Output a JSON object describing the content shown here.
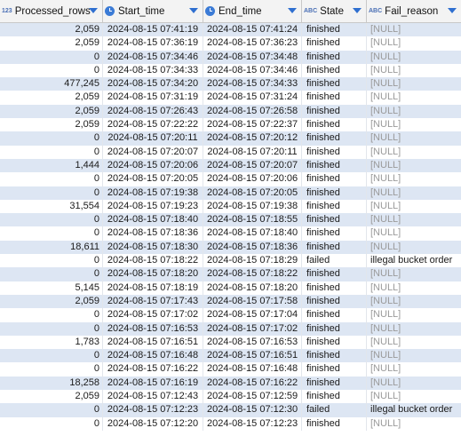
{
  "columns": {
    "processed_rows": {
      "type_icon": "123",
      "label": "Processed_rows"
    },
    "start_time": {
      "type_icon": "clock-icon",
      "label": "Start_time"
    },
    "end_time": {
      "type_icon": "clock-icon",
      "label": "End_time"
    },
    "state": {
      "type_icon": "ABC",
      "label": "State"
    },
    "fail_reason": {
      "type_icon": "ABC",
      "label": "Fail_reason"
    }
  },
  "colors": {
    "row_alt": "#dde6f3",
    "null_text": "#9a9a9a",
    "accent": "#2f6fd0"
  },
  "rows": [
    {
      "processed_rows": "2,059",
      "start_time": "2024-08-15 07:41:19",
      "end_time": "2024-08-15 07:41:24",
      "state": "finished",
      "fail_reason": "[NULL]"
    },
    {
      "processed_rows": "2,059",
      "start_time": "2024-08-15 07:36:19",
      "end_time": "2024-08-15 07:36:23",
      "state": "finished",
      "fail_reason": "[NULL]"
    },
    {
      "processed_rows": "0",
      "start_time": "2024-08-15 07:34:46",
      "end_time": "2024-08-15 07:34:48",
      "state": "finished",
      "fail_reason": "[NULL]"
    },
    {
      "processed_rows": "0",
      "start_time": "2024-08-15 07:34:33",
      "end_time": "2024-08-15 07:34:46",
      "state": "finished",
      "fail_reason": "[NULL]"
    },
    {
      "processed_rows": "477,245",
      "start_time": "2024-08-15 07:34:20",
      "end_time": "2024-08-15 07:34:33",
      "state": "finished",
      "fail_reason": "[NULL]"
    },
    {
      "processed_rows": "2,059",
      "start_time": "2024-08-15 07:31:19",
      "end_time": "2024-08-15 07:31:24",
      "state": "finished",
      "fail_reason": "[NULL]"
    },
    {
      "processed_rows": "2,059",
      "start_time": "2024-08-15 07:26:43",
      "end_time": "2024-08-15 07:26:58",
      "state": "finished",
      "fail_reason": "[NULL]"
    },
    {
      "processed_rows": "2,059",
      "start_time": "2024-08-15 07:22:22",
      "end_time": "2024-08-15 07:22:37",
      "state": "finished",
      "fail_reason": "[NULL]"
    },
    {
      "processed_rows": "0",
      "start_time": "2024-08-15 07:20:11",
      "end_time": "2024-08-15 07:20:12",
      "state": "finished",
      "fail_reason": "[NULL]"
    },
    {
      "processed_rows": "0",
      "start_time": "2024-08-15 07:20:07",
      "end_time": "2024-08-15 07:20:11",
      "state": "finished",
      "fail_reason": "[NULL]"
    },
    {
      "processed_rows": "1,444",
      "start_time": "2024-08-15 07:20:06",
      "end_time": "2024-08-15 07:20:07",
      "state": "finished",
      "fail_reason": "[NULL]"
    },
    {
      "processed_rows": "0",
      "start_time": "2024-08-15 07:20:05",
      "end_time": "2024-08-15 07:20:06",
      "state": "finished",
      "fail_reason": "[NULL]"
    },
    {
      "processed_rows": "0",
      "start_time": "2024-08-15 07:19:38",
      "end_time": "2024-08-15 07:20:05",
      "state": "finished",
      "fail_reason": "[NULL]"
    },
    {
      "processed_rows": "31,554",
      "start_time": "2024-08-15 07:19:23",
      "end_time": "2024-08-15 07:19:38",
      "state": "finished",
      "fail_reason": "[NULL]"
    },
    {
      "processed_rows": "0",
      "start_time": "2024-08-15 07:18:40",
      "end_time": "2024-08-15 07:18:55",
      "state": "finished",
      "fail_reason": "[NULL]"
    },
    {
      "processed_rows": "0",
      "start_time": "2024-08-15 07:18:36",
      "end_time": "2024-08-15 07:18:40",
      "state": "finished",
      "fail_reason": "[NULL]"
    },
    {
      "processed_rows": "18,611",
      "start_time": "2024-08-15 07:18:30",
      "end_time": "2024-08-15 07:18:36",
      "state": "finished",
      "fail_reason": "[NULL]"
    },
    {
      "processed_rows": "0",
      "start_time": "2024-08-15 07:18:22",
      "end_time": "2024-08-15 07:18:29",
      "state": "failed",
      "fail_reason": "illegal bucket order"
    },
    {
      "processed_rows": "0",
      "start_time": "2024-08-15 07:18:20",
      "end_time": "2024-08-15 07:18:22",
      "state": "finished",
      "fail_reason": "[NULL]"
    },
    {
      "processed_rows": "5,145",
      "start_time": "2024-08-15 07:18:19",
      "end_time": "2024-08-15 07:18:20",
      "state": "finished",
      "fail_reason": "[NULL]"
    },
    {
      "processed_rows": "2,059",
      "start_time": "2024-08-15 07:17:43",
      "end_time": "2024-08-15 07:17:58",
      "state": "finished",
      "fail_reason": "[NULL]"
    },
    {
      "processed_rows": "0",
      "start_time": "2024-08-15 07:17:02",
      "end_time": "2024-08-15 07:17:04",
      "state": "finished",
      "fail_reason": "[NULL]"
    },
    {
      "processed_rows": "0",
      "start_time": "2024-08-15 07:16:53",
      "end_time": "2024-08-15 07:17:02",
      "state": "finished",
      "fail_reason": "[NULL]"
    },
    {
      "processed_rows": "1,783",
      "start_time": "2024-08-15 07:16:51",
      "end_time": "2024-08-15 07:16:53",
      "state": "finished",
      "fail_reason": "[NULL]"
    },
    {
      "processed_rows": "0",
      "start_time": "2024-08-15 07:16:48",
      "end_time": "2024-08-15 07:16:51",
      "state": "finished",
      "fail_reason": "[NULL]"
    },
    {
      "processed_rows": "0",
      "start_time": "2024-08-15 07:16:22",
      "end_time": "2024-08-15 07:16:48",
      "state": "finished",
      "fail_reason": "[NULL]"
    },
    {
      "processed_rows": "18,258",
      "start_time": "2024-08-15 07:16:19",
      "end_time": "2024-08-15 07:16:22",
      "state": "finished",
      "fail_reason": "[NULL]"
    },
    {
      "processed_rows": "2,059",
      "start_time": "2024-08-15 07:12:43",
      "end_time": "2024-08-15 07:12:59",
      "state": "finished",
      "fail_reason": "[NULL]"
    },
    {
      "processed_rows": "0",
      "start_time": "2024-08-15 07:12:23",
      "end_time": "2024-08-15 07:12:30",
      "state": "failed",
      "fail_reason": "illegal bucket order"
    },
    {
      "processed_rows": "0",
      "start_time": "2024-08-15 07:12:20",
      "end_time": "2024-08-15 07:12:23",
      "state": "finished",
      "fail_reason": "[NULL]"
    }
  ]
}
